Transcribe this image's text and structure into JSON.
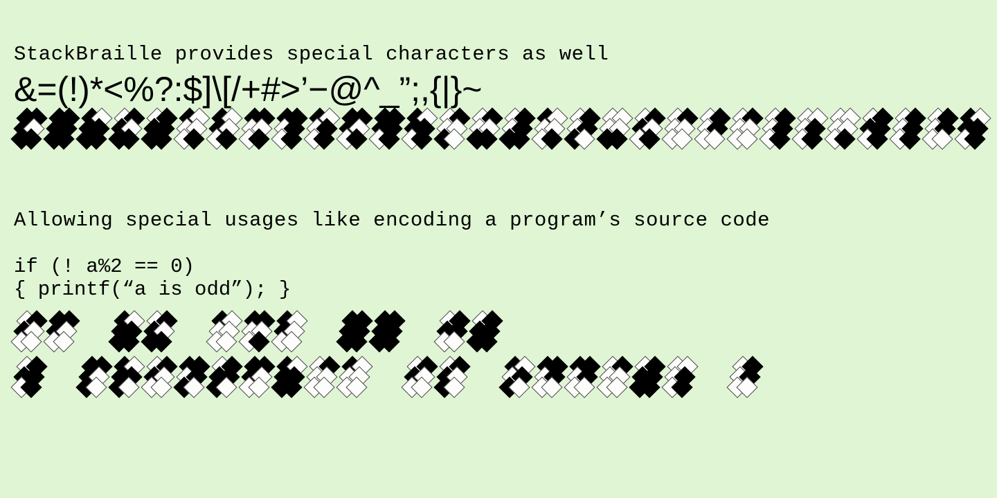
{
  "intro": "StackBraille provides special characters as well",
  "symbols": "&=(!)*<%?:$]\\[/+#>’−@^_”;,{|}~",
  "braille_symbol_patterns": [
    "123468",
    "123456",
    "12356",
    "2346",
    "23456",
    "16",
    "126",
    "146",
    "1456",
    "156",
    "1246",
    "12456",
    "1256",
    "34",
    "346",
    "3456",
    "16",
    "345",
    "36",
    "246",
    "47",
    "45",
    "4",
    "456",
    "56",
    "6",
    "2456",
    "456",
    "45",
    "1256"
  ],
  "allowing": "Allowing special usages like encoding a program’s source code",
  "code_line1": "if (! a%2 == 0)",
  "code_line2": "{ printf(“a is odd”); }",
  "code_braille_line1": [
    [
      "24",
      "124"
    ],
    [],
    [
      "12356",
      "2346"
    ],
    [],
    [
      "1",
      "146",
      "12"
    ],
    [],
    [
      "123456",
      "123456"
    ],
    [],
    [
      "245",
      "23456"
    ]
  ],
  "code_braille_line2": [
    [
      "2456"
    ],
    [],
    [
      "1234",
      "1235",
      "24",
      "1345",
      "2345",
      "124",
      "12356"
    ],
    [
      "4",
      "1"
    ],
    [],
    [
      "24",
      "234"
    ],
    [],
    [
      "135",
      "145",
      "145",
      "4",
      "23456",
      "56"
    ],
    [],
    [
      "45"
    ]
  ]
}
